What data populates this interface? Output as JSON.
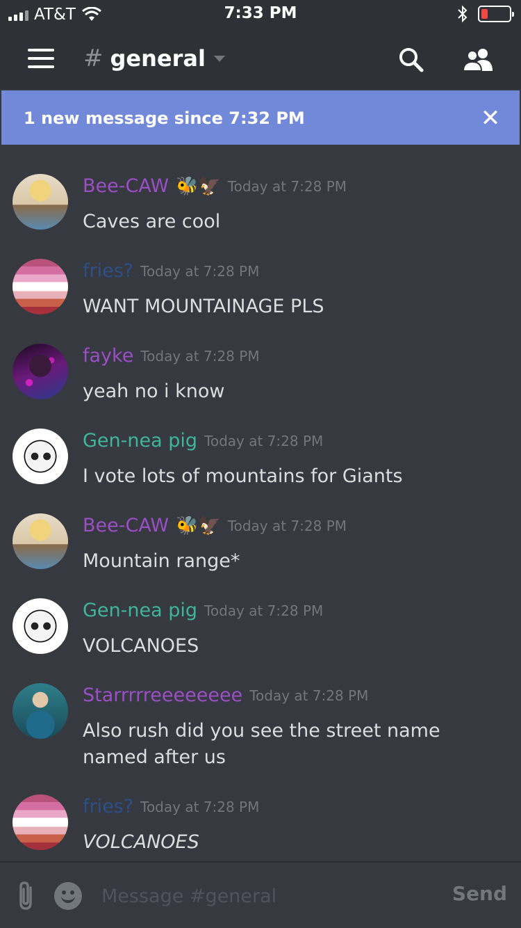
{
  "status": {
    "carrier": "AT&T",
    "time": "7:33 PM"
  },
  "header": {
    "hash": "#",
    "channel": "general"
  },
  "banner": {
    "text": "1 new message since 7:32 PM",
    "close": "✕"
  },
  "colors": {
    "brand": "#7289da",
    "purple": "#9a4fc6",
    "blue": "#2d4f88",
    "teal": "#3fb59a"
  },
  "messages": [
    {
      "author": "Bee-CAW",
      "color": "#9a4fc6",
      "emoji": "🐝🦅",
      "time": "Today at 7:28 PM",
      "text": "Caves are cool",
      "avatar": "blonde"
    },
    {
      "author": "fries?",
      "color": "#2d4f88",
      "emoji": "",
      "time": "Today at 7:28 PM",
      "text": "WANT MOUNTAINAGE PLS",
      "avatar": "stripes"
    },
    {
      "author": "fayke",
      "color": "#9a4fc6",
      "emoji": "",
      "time": "Today at 7:28 PM",
      "text": "yeah no i know",
      "avatar": "dark"
    },
    {
      "author": "Gen-nea pig",
      "color": "#3fb59a",
      "emoji": "",
      "time": "Today at 7:28 PM",
      "text": "I vote lots of mountains for Giants",
      "avatar": "skull"
    },
    {
      "author": "Bee-CAW",
      "color": "#9a4fc6",
      "emoji": "🐝🦅",
      "time": "Today at 7:28 PM",
      "text": "Mountain range*",
      "avatar": "blonde"
    },
    {
      "author": "Gen-nea pig",
      "color": "#3fb59a",
      "emoji": "",
      "time": "Today at 7:28 PM",
      "text": "VOLCANOES",
      "avatar": "skull"
    },
    {
      "author": "Starrrrreeeeeeee",
      "color": "#9a4fc6",
      "emoji": "",
      "time": "Today at 7:28 PM",
      "text": "Also rush did you see the street name named after us",
      "avatar": "teal"
    },
    {
      "author": "fries?",
      "color": "#2d4f88",
      "emoji": "",
      "time": "Today at 7:28 PM",
      "text": "VOLCANOES",
      "avatar": "stripes",
      "italic": true
    }
  ],
  "composer": {
    "placeholder": "Message #general",
    "send": "Send"
  }
}
